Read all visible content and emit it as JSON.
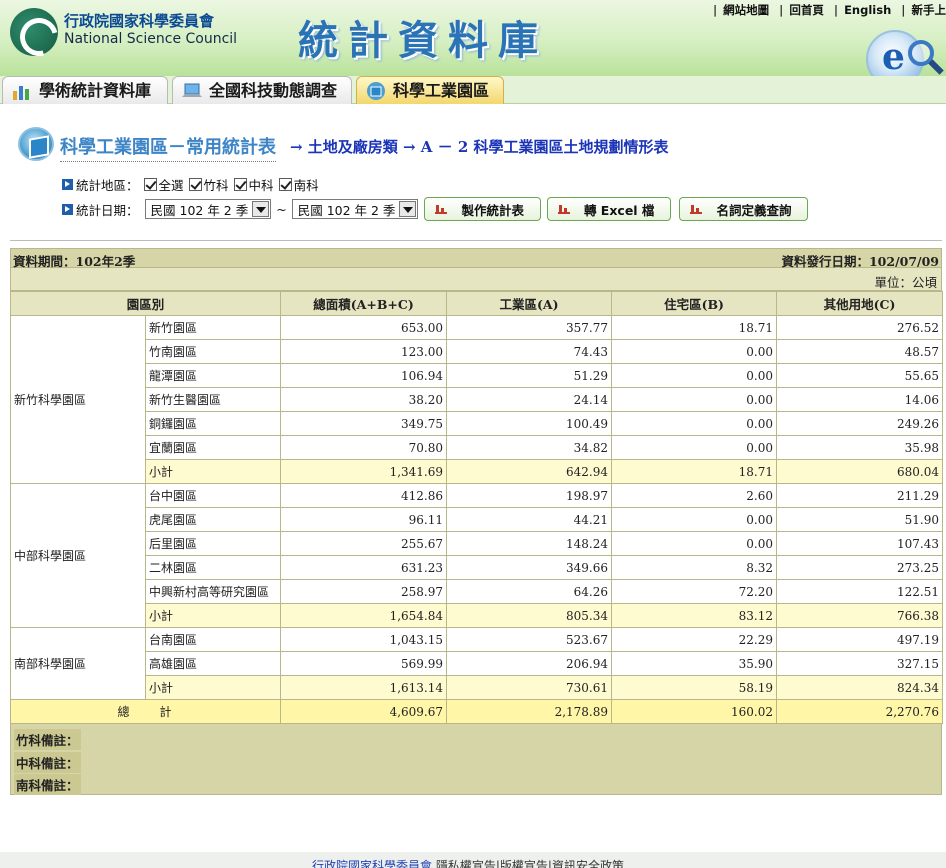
{
  "header": {
    "org_cn": "行政院國家科學委員會",
    "org_en": "National Science Council",
    "site_title": "統計資料庫",
    "top_links": [
      "網站地圖",
      "回首頁",
      "English",
      "新手上"
    ],
    "badge_letter": "e"
  },
  "tabs": [
    {
      "label": "學術統計資料庫",
      "active": false
    },
    {
      "label": "全國科技動態調查",
      "active": false
    },
    {
      "label": "科學工業園區",
      "active": true
    }
  ],
  "page": {
    "title": "科學工業園區－常用統計表",
    "path": "→ 土地及廠房類 → A － 2  科學工業園區土地規劃情形表"
  },
  "filters": {
    "region_label": "統計地區：",
    "regions": [
      "全選",
      "竹科",
      "中科",
      "南科"
    ],
    "date_label": "統計日期：",
    "date_from": "民國 102 年 2 季",
    "date_sep": "~",
    "date_to": "民國 102 年 2 季",
    "buttons": [
      "製作統計表",
      "轉 Excel 檔",
      "名詞定義查詢"
    ]
  },
  "table": {
    "period": "資料期間：102年2季",
    "release": "資料發行日期：102/07/09",
    "unit": "單位：公頃",
    "headers": [
      "園區別",
      "總面積(A+B+C)",
      "工業區(A)",
      "住宅區(B)",
      "其他用地(C)"
    ],
    "groups": [
      {
        "region": "新竹科學園區",
        "rows": [
          {
            "park": "新竹園區",
            "total": "653.00",
            "industrial": "357.77",
            "residential": "18.71",
            "other": "276.52"
          },
          {
            "park": "竹南園區",
            "total": "123.00",
            "industrial": "74.43",
            "residential": "0.00",
            "other": "48.57"
          },
          {
            "park": "龍潭園區",
            "total": "106.94",
            "industrial": "51.29",
            "residential": "0.00",
            "other": "55.65"
          },
          {
            "park": "新竹生醫園區",
            "total": "38.20",
            "industrial": "24.14",
            "residential": "0.00",
            "other": "14.06"
          },
          {
            "park": "銅鑼園區",
            "total": "349.75",
            "industrial": "100.49",
            "residential": "0.00",
            "other": "249.26"
          },
          {
            "park": "宜蘭園區",
            "total": "70.80",
            "industrial": "34.82",
            "residential": "0.00",
            "other": "35.98"
          },
          {
            "park": "小計",
            "total": "1,341.69",
            "industrial": "642.94",
            "residential": "18.71",
            "other": "680.04"
          }
        ]
      },
      {
        "region": "中部科學園區",
        "rows": [
          {
            "park": "台中園區",
            "total": "412.86",
            "industrial": "198.97",
            "residential": "2.60",
            "other": "211.29"
          },
          {
            "park": "虎尾園區",
            "total": "96.11",
            "industrial": "44.21",
            "residential": "0.00",
            "other": "51.90"
          },
          {
            "park": "后里園區",
            "total": "255.67",
            "industrial": "148.24",
            "residential": "0.00",
            "other": "107.43"
          },
          {
            "park": "二林園區",
            "total": "631.23",
            "industrial": "349.66",
            "residential": "8.32",
            "other": "273.25"
          },
          {
            "park": "中興新村高等研究園區",
            "total": "258.97",
            "industrial": "64.26",
            "residential": "72.20",
            "other": "122.51"
          },
          {
            "park": "小計",
            "total": "1,654.84",
            "industrial": "805.34",
            "residential": "83.12",
            "other": "766.38"
          }
        ]
      },
      {
        "region": "南部科學園區",
        "rows": [
          {
            "park": "台南園區",
            "total": "1,043.15",
            "industrial": "523.67",
            "residential": "22.29",
            "other": "497.19"
          },
          {
            "park": "高雄園區",
            "total": "569.99",
            "industrial": "206.94",
            "residential": "35.90",
            "other": "327.15"
          },
          {
            "park": "小計",
            "total": "1,613.14",
            "industrial": "730.61",
            "residential": "58.19",
            "other": "824.34"
          }
        ]
      }
    ],
    "grand_total": {
      "label": "總　　計",
      "total": "4,609.67",
      "industrial": "2,178.89",
      "residential": "160.02",
      "other": "2,270.76"
    }
  },
  "notes": [
    "竹科備註：",
    "中科備註：",
    "南科備註："
  ],
  "footer": {
    "link": "行政院國家科學委員會",
    "items": [
      "隱私權宣告",
      "版權宣告",
      "資訊安全政策"
    ]
  }
}
